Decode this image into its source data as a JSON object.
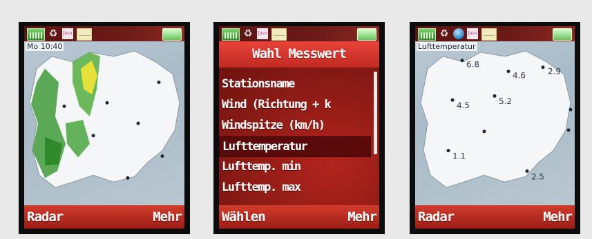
{
  "phones": [
    {
      "overlay_label": "Mo 10:40",
      "softkeys": {
        "left": "Radar",
        "right": "Mehr"
      },
      "status_icons": [
        "signal-icon",
        "sync-icon",
        "java-icon",
        "mail-icon",
        "battery-icon"
      ]
    },
    {
      "title": "Wahl Messwert",
      "items": [
        "Stationsname",
        "Wind (Richtung + k",
        "Windspitze (km/h)",
        "Lufttemperatur",
        "Lufttemp. min",
        "Lufttemp. max"
      ],
      "selected_index": 3,
      "softkeys": {
        "left": "Wählen",
        "right": "Mehr"
      },
      "status_icons": [
        "signal-icon",
        "sync-icon",
        "java-icon",
        "mail-icon",
        "battery-icon"
      ]
    },
    {
      "overlay_label": "Lufttemperatur",
      "values": [
        "6.8",
        "4.6",
        "2.9",
        "4.5",
        "5.2",
        "1.1",
        "2.5"
      ],
      "softkeys": {
        "left": "Radar",
        "right": "Mehr"
      },
      "status_icons": [
        "signal-icon",
        "sync-icon",
        "globe-icon",
        "java-icon",
        "mail-icon",
        "battery-icon"
      ]
    }
  ],
  "colors": {
    "softkey_bar": "#c22f24",
    "menu_title": "#d83a31",
    "selection": "#5a0a0a",
    "page_bg": "#e9e9e9"
  }
}
